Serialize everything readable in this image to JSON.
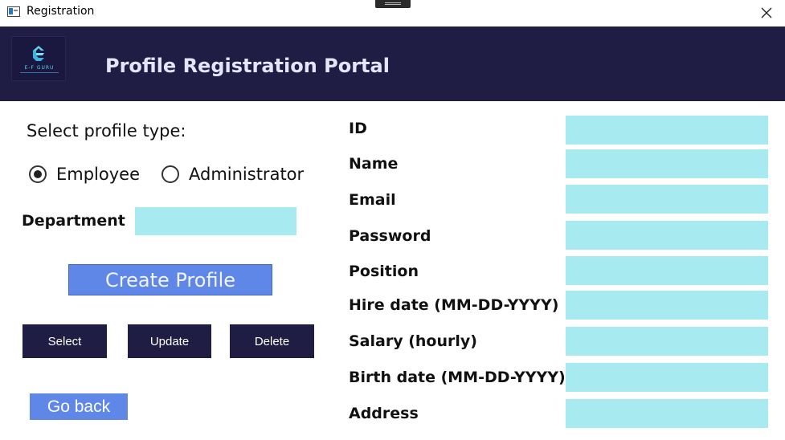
{
  "window": {
    "title": "Registration",
    "icons": {
      "app": "window-app-icon",
      "close": "close-icon"
    }
  },
  "header": {
    "title": "Profile Registration Portal",
    "logo_text": "E-F GURU",
    "background": "#201d44"
  },
  "profile_type": {
    "label": "Select profile type:",
    "options": [
      {
        "label": "Employee",
        "selected": true
      },
      {
        "label": "Administrator",
        "selected": false
      }
    ]
  },
  "department": {
    "label": "Department",
    "value": ""
  },
  "buttons": {
    "create": "Create Profile",
    "select": "Select",
    "update": "Update",
    "delete": "Delete",
    "go_back": "Go back"
  },
  "form": {
    "fields": [
      {
        "label": "ID",
        "value": ""
      },
      {
        "label": "Name",
        "value": ""
      },
      {
        "label": "Email",
        "value": ""
      },
      {
        "label": "Password",
        "value": ""
      },
      {
        "label": "Position",
        "value": ""
      },
      {
        "label": "Hire date (MM-DD-YYYY)",
        "value": ""
      },
      {
        "label": "Salary (hourly)",
        "value": ""
      },
      {
        "label": "Birth date (MM-DD-YYYY)",
        "value": ""
      },
      {
        "label": "Address",
        "value": ""
      }
    ]
  },
  "colors": {
    "accent_blue": "#5e87e7",
    "input_cyan": "#a7eaf0",
    "dark_navy": "#201d44"
  }
}
